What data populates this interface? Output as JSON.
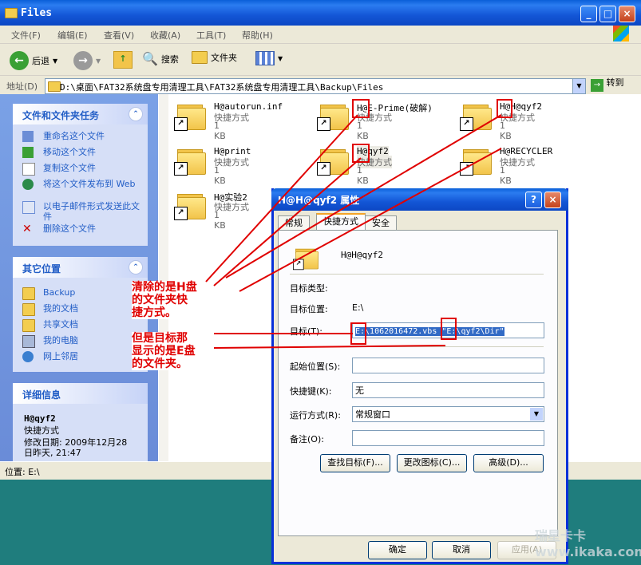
{
  "window": {
    "title": "Files",
    "caption_buttons": [
      "_",
      "□",
      "×"
    ]
  },
  "menu": [
    "文件(F)",
    "编辑(E)",
    "查看(V)",
    "收藏(A)",
    "工具(T)",
    "帮助(H)"
  ],
  "toolbar": {
    "back": "后退",
    "search": "搜索",
    "folders": "文件夹"
  },
  "address": {
    "label": "地址(D)",
    "path": "D:\\桌面\\FAT32系统盘专用清理工具\\FAT32系统盘专用清理工具\\Backup\\Files",
    "go": "转到"
  },
  "tasks_panel": {
    "title": "文件和文件夹任务",
    "items": [
      "重命名这个文件",
      "移动这个文件",
      "复制这个文件",
      "将这个文件发布到 Web",
      "以电子邮件形式发送此文件",
      "删除这个文件"
    ]
  },
  "places_panel": {
    "title": "其它位置",
    "items": [
      "Backup",
      "我的文档",
      "共享文档",
      "我的电脑",
      "网上邻居"
    ]
  },
  "details_panel": {
    "title": "详细信息",
    "name": "H@qyf2",
    "type": "快捷方式",
    "modified": "修改日期: 2009年12月28",
    "modified2": "日昨天, 21:47"
  },
  "files": [
    {
      "name": "H@autorun.inf",
      "type": "快捷方式",
      "size": "1 KB"
    },
    {
      "name": "H@E-Prime(破解)",
      "type": "快捷方式",
      "size": "1 KB"
    },
    {
      "name": "H@H@qyf2",
      "type": "快捷方式",
      "size": "1 KB"
    },
    {
      "name": "H@print",
      "type": "快捷方式",
      "size": "1 KB"
    },
    {
      "name": "H@qyf2",
      "type": "快捷方式",
      "size": "1 KB"
    },
    {
      "name": "H@RECYCLER",
      "type": "快捷方式",
      "size": "1 KB"
    },
    {
      "name": "H@实验2",
      "type": "快捷方式",
      "size": "1 KB"
    }
  ],
  "status": "位置: E:\\",
  "dialog": {
    "title": "H@H@qyf2 属性",
    "tabs": [
      "常规",
      "快捷方式",
      "安全"
    ],
    "name": "H@H@qyf2",
    "target_type_label": "目标类型:",
    "target_loc_label": "目标位置:",
    "target_loc_value": "E:\\",
    "target_label": "目标(T):",
    "target_value": "E:\\1062016472.vbs \"E:\\qyf2\\Dir\"",
    "start_label": "起始位置(S):",
    "start_value": "",
    "hotkey_label": "快捷键(K):",
    "hotkey_value": "无",
    "run_label": "运行方式(R):",
    "run_value": "常规窗口",
    "comment_label": "备注(O):",
    "comment_value": "",
    "find_btn": "查找目标(F)...",
    "icon_btn": "更改图标(C)...",
    "adv_btn": "高级(D)...",
    "ok": "确定",
    "cancel": "取消",
    "apply": "应用(A)"
  },
  "annotations": {
    "note1": [
      "清除的是H盘",
      "的文件夹快",
      "捷方式。"
    ],
    "note2": [
      "但是目标那",
      "显示的是E盘",
      "的文件夹。"
    ]
  },
  "watermark": "瑞星卡卡 www.ikaka.com"
}
